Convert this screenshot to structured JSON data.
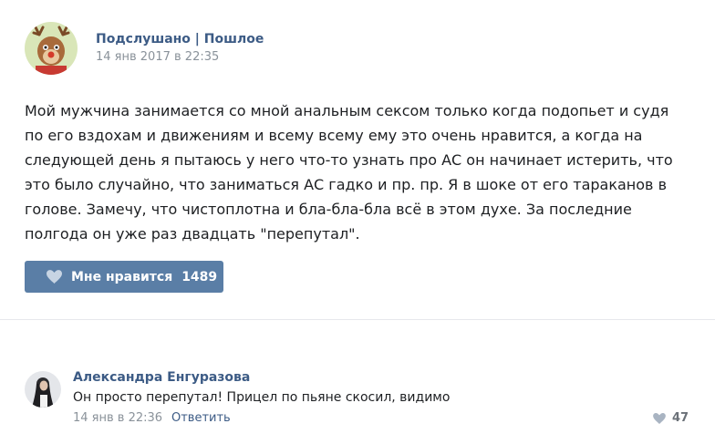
{
  "post": {
    "author": "Подслушано | Пошлое",
    "date": "14 янв 2017 в 22:35",
    "text": "Мой мужчина занимается со мной анальным сексом только когда подопьет и судя по его вздохам и движениям и всему всему ему это очень нравится, а когда на следующей день я пытаюсь у него что-то узнать про АС он начинает истерить, что это было случайно, что заниматься АС гадко и пр. пр. Я в шоке от его тараканов в голове. Замечу, что чистоплотна и бла-бла-бла всё в этом духе. За последние полгода он уже раз двадцать \"перепутал\".",
    "like_label": "Мне нравится",
    "like_count": "1489",
    "avatar_icon": "deer-avatar-icon"
  },
  "comment": {
    "author": "Александра Енгуразова",
    "text": "Он просто перепутал! Прицел по пьяне скосил, видимо",
    "date": "14 янв в 22:36",
    "reply_label": "Ответить",
    "like_count": "47",
    "avatar_icon": "user-avatar-icon"
  },
  "colors": {
    "link": "#3c5b85",
    "like_button": "#5a7ea6",
    "meta": "#8a929a"
  }
}
